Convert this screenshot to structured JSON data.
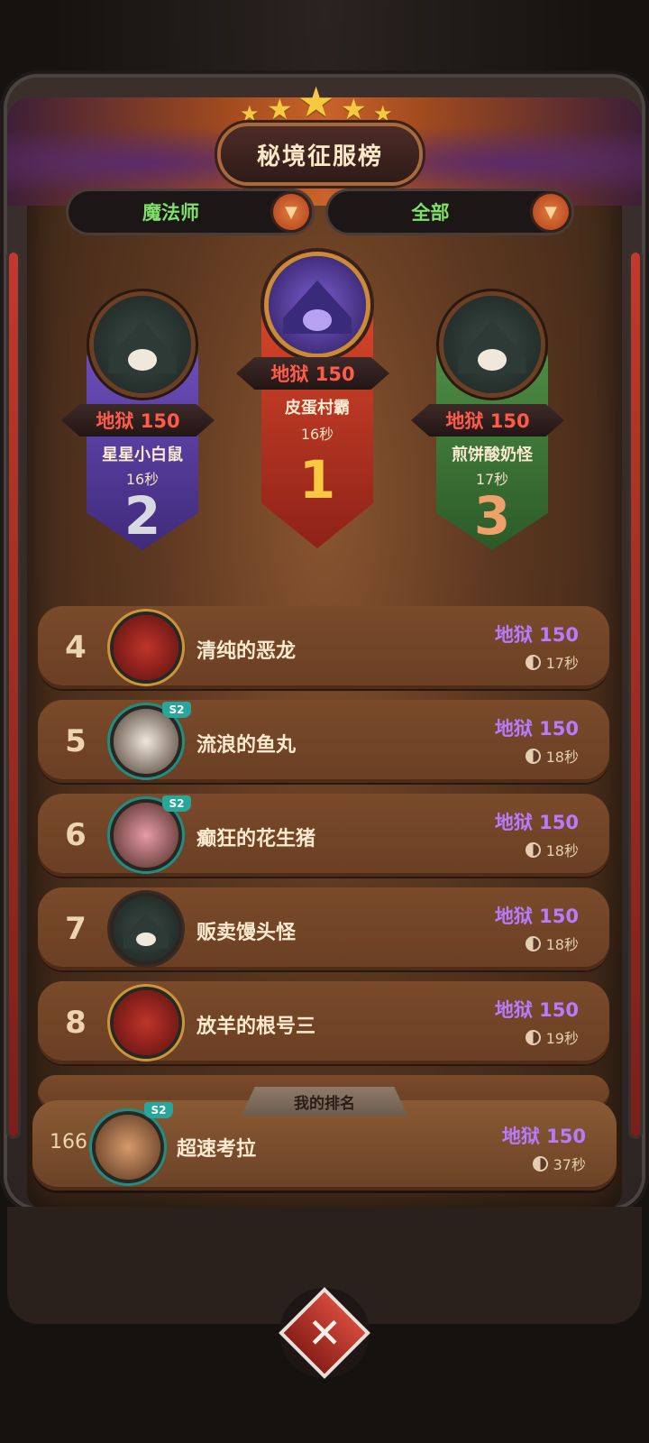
{
  "title": "秘境征服榜",
  "filters": {
    "class_label": "魔法师",
    "scope_label": "全部",
    "arrow_icon": "▼"
  },
  "podium": [
    {
      "rank": "1",
      "score": "地狱 150",
      "name": "皮蛋村霸",
      "time": "16秒"
    },
    {
      "rank": "2",
      "score": "地狱 150",
      "name": "星星小白鼠",
      "time": "16秒"
    },
    {
      "rank": "3",
      "score": "地狱 150",
      "name": "煎饼酸奶怪",
      "time": "17秒"
    }
  ],
  "rows": [
    {
      "rank": "4",
      "name": "清纯的恶龙",
      "score": "地狱 150",
      "time": "17秒",
      "badge": ""
    },
    {
      "rank": "5",
      "name": "流浪的鱼丸",
      "score": "地狱 150",
      "time": "18秒",
      "badge": "S2"
    },
    {
      "rank": "6",
      "name": "癫狂的花生猪",
      "score": "地狱 150",
      "time": "18秒",
      "badge": "S2"
    },
    {
      "rank": "7",
      "name": "贩卖馒头怪",
      "score": "地狱 150",
      "time": "18秒",
      "badge": ""
    },
    {
      "rank": "8",
      "name": "放羊的根号三",
      "score": "地狱 150",
      "time": "19秒",
      "badge": ""
    }
  ],
  "my_rank": {
    "tab_label": "我的排名",
    "rank": "166",
    "name": "超速考拉",
    "score": "地狱 150",
    "time": "37秒",
    "badge": "S2"
  },
  "close_icon": "✕",
  "colors": {
    "score_red": "#ff5b4a",
    "score_purple": "#b87bff",
    "filter_green": "#7fe06a",
    "rank1_banner": "#c8412a",
    "rank2_banner": "#5b3fa0",
    "rank3_banner": "#3f7a3a"
  }
}
